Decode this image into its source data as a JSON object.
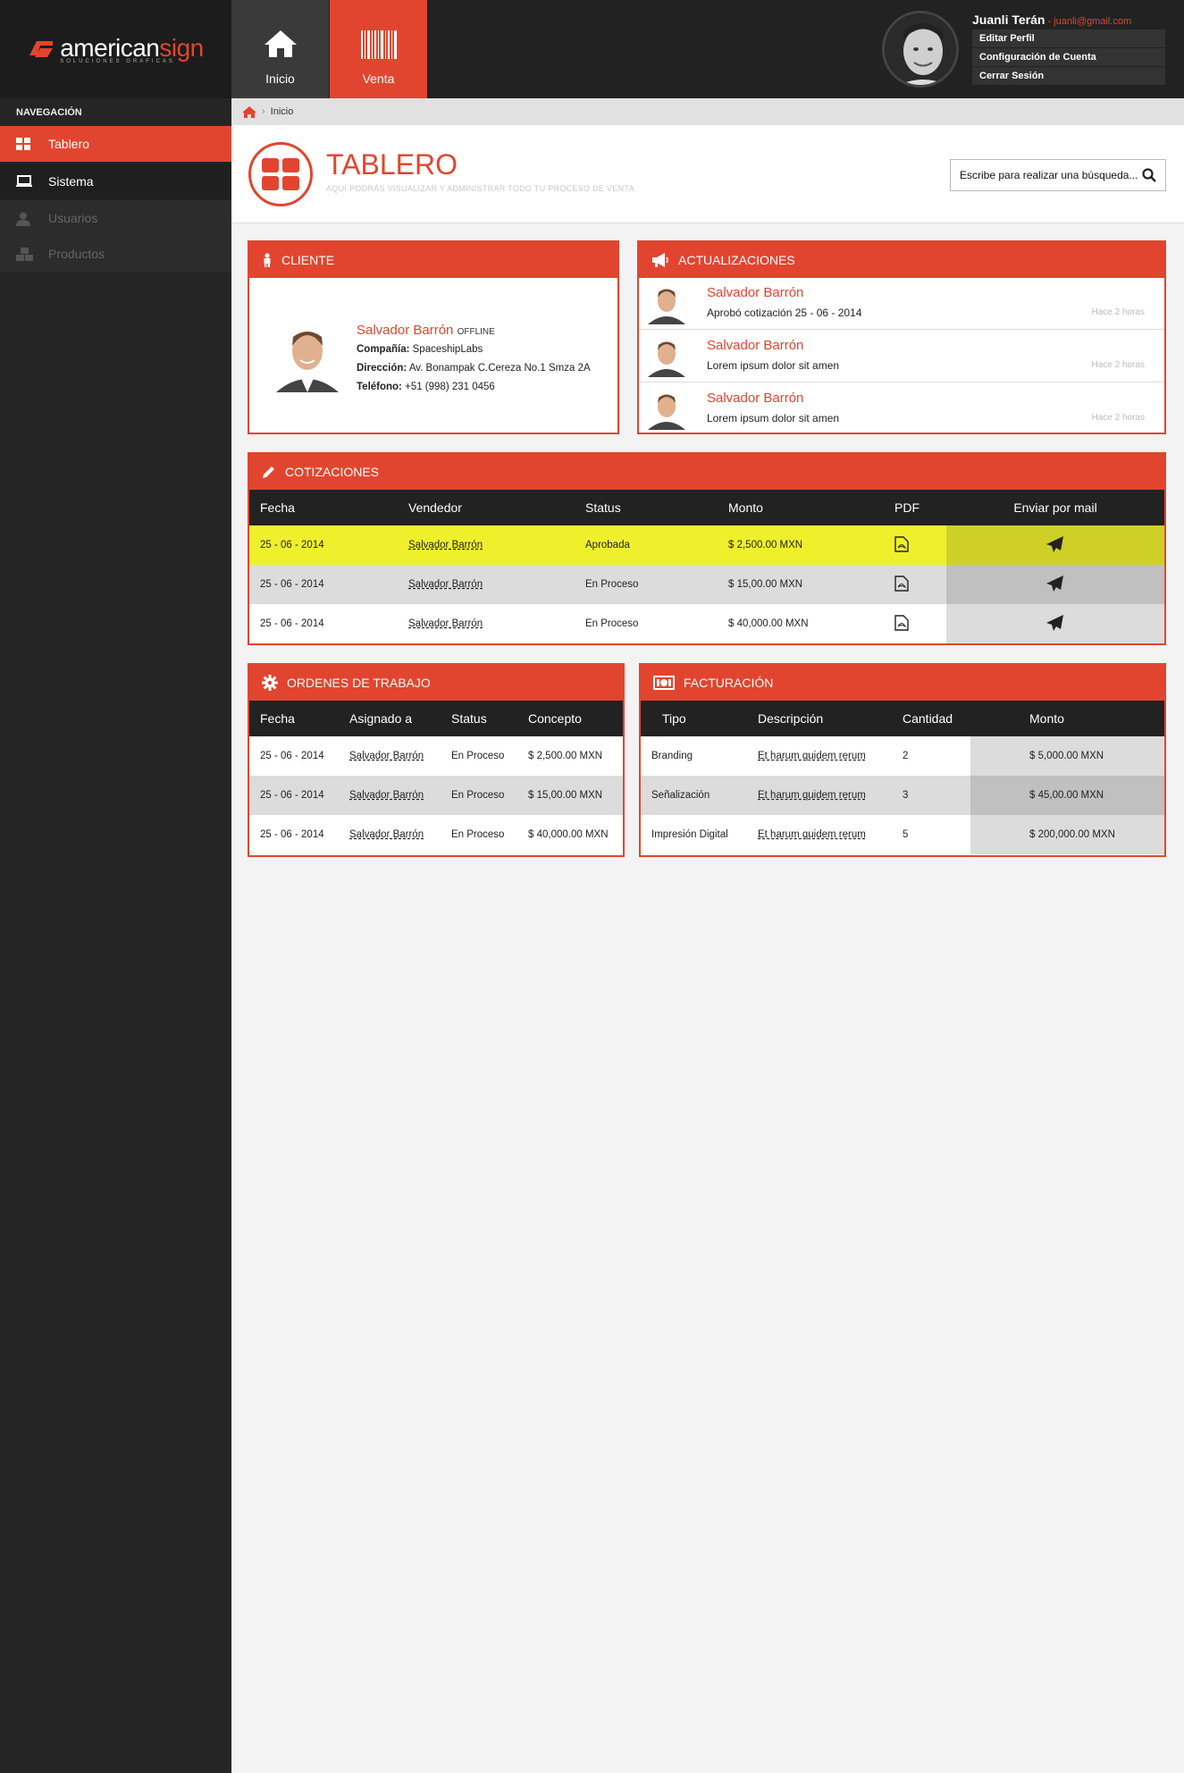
{
  "brand": {
    "name_part1": "american",
    "name_part2": "sign",
    "tagline": "SOLUCIONES GRAFICAS"
  },
  "sidebar": {
    "title": "NAVEGACIÓN",
    "items": [
      {
        "label": "Tablero",
        "icon": "grid-icon",
        "active": true
      },
      {
        "label": "Sistema",
        "icon": "laptop-icon",
        "active": false
      },
      {
        "label": "Usuarios",
        "icon": "user-icon",
        "disabled": true
      },
      {
        "label": "Productos",
        "icon": "boxes-icon",
        "disabled": true
      }
    ]
  },
  "topbar": {
    "tabs": [
      {
        "label": "Inicio",
        "icon": "home-icon"
      },
      {
        "label": "Venta",
        "icon": "barcode-icon",
        "active": true
      }
    ],
    "user": {
      "name": "Juanli Terán",
      "email": "- juanli@gmail.com",
      "menu": [
        "Editar Perfil",
        "Configuración de Cuenta",
        "Cerrar Sesión"
      ]
    }
  },
  "breadcrumb": {
    "current": "Inicio"
  },
  "header": {
    "title": "TABLERO",
    "subtitle": "AQUÍ PODRÁS VISUALIZAR Y ADMINISTRAR TODO TU PROCESO DE VENTA",
    "search_placeholder": "Escribe para realizar una búsqueda..."
  },
  "cliente": {
    "title": "CLIENTE",
    "name": "Salvador Barrón",
    "status": "OFFLINE",
    "company_label": "Compañía:",
    "company": "SpaceshipLabs",
    "address_label": "Dirección:",
    "address": "Av. Bonampak C.Cereza No.1 Smza 2A",
    "phone_label": "Teléfono:",
    "phone": "+51 (998) 231 0456"
  },
  "actualizaciones": {
    "title": "ACTUALIZACIONES",
    "items": [
      {
        "name": "Salvador Barrón",
        "text": "Aprobó cotización 25 - 06 - 2014",
        "time": "Hace 2 horas"
      },
      {
        "name": "Salvador Barrón",
        "text": "Lorem ipsum dolor sit amen",
        "time": "Hace 2 horas"
      },
      {
        "name": "Salvador Barrón",
        "text": "Lorem ipsum dolor sit amen",
        "time": "Hace 2 horas"
      }
    ]
  },
  "cotizaciones": {
    "title": "COTIZACIONES",
    "headers": [
      "Fecha",
      "Vendedor",
      "Status",
      "Monto",
      "PDF",
      "Enviar por mail"
    ],
    "rows": [
      {
        "fecha": "25 - 06 - 2014",
        "vendedor": "Salvador Barrón",
        "status": "Aprobada",
        "monto": "$ 2,500.00 MXN"
      },
      {
        "fecha": "25 - 06 - 2014",
        "vendedor": "Salvador Barrón",
        "status": "En Proceso",
        "monto": "$ 15,00.00 MXN"
      },
      {
        "fecha": "25 - 06 - 2014",
        "vendedor": "Salvador Barrón",
        "status": "En Proceso",
        "monto": "$ 40,000.00 MXN"
      }
    ]
  },
  "ordenes": {
    "title": "ORDENES DE TRABAJO",
    "headers": [
      "Fecha",
      "Asignado a",
      "Status",
      "Concepto"
    ],
    "rows": [
      {
        "fecha": "25 - 06 - 2014",
        "asignado": "Salvador Barrón",
        "status": "En Proceso",
        "concepto": "$ 2,500.00 MXN"
      },
      {
        "fecha": "25 - 06 - 2014",
        "asignado": "Salvador Barrón",
        "status": "En Proceso",
        "concepto": "$ 15,00.00 MXN"
      },
      {
        "fecha": "25 - 06 - 2014",
        "asignado": "Salvador Barrón",
        "status": "En Proceso",
        "concepto": "$ 40,000.00 MXN"
      }
    ]
  },
  "facturacion": {
    "title": "FACTURACIÓN",
    "headers": [
      "Tipo",
      "Descripción",
      "Cantidad",
      "Monto"
    ],
    "rows": [
      {
        "tipo": "Branding",
        "descripcion": "Et harum quidem rerum",
        "cantidad": "2",
        "monto": "$ 5,000.00 MXN"
      },
      {
        "tipo": "Señalización",
        "descripcion": "Et harum quidem rerum",
        "cantidad": "3",
        "monto": "$ 45,00.00 MXN"
      },
      {
        "tipo": "Impresión Digital",
        "descripcion": "Et harum quidem rerum",
        "cantidad": "5",
        "monto": "$ 200,000.00 MXN"
      }
    ]
  },
  "colors": {
    "accent": "#e2452f",
    "dark": "#222222",
    "highlight": "#eff02b",
    "highlight_dark": "#cfd027",
    "row_alt": "#dcdcdc",
    "row_alt_dark": "#c0c0c0"
  }
}
